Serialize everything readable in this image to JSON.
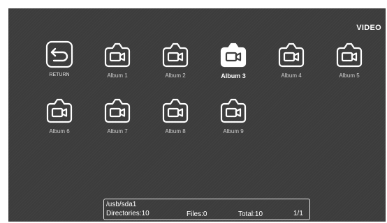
{
  "header": {
    "mode_label": "VIDEO"
  },
  "grid": {
    "return_label": "RETURN",
    "selected_index": 2,
    "folders": [
      "Album 1",
      "Album 2",
      "Album 3",
      "Album 4",
      "Album 5",
      "Album 6",
      "Album 7",
      "Album 8",
      "Album 9"
    ],
    "icons": {
      "return": "return-arrow-icon",
      "folder": "video-folder-icon"
    }
  },
  "status": {
    "path": "/usb/sda1",
    "directories": "Directories:10",
    "files": "Files:0",
    "total": "Total:10",
    "page": "1/1"
  },
  "colors": {
    "background": "#3c3c3c",
    "icon_stroke": "#ffffff",
    "selected_fill": "#ffffff",
    "label": "#cfcfcf"
  }
}
